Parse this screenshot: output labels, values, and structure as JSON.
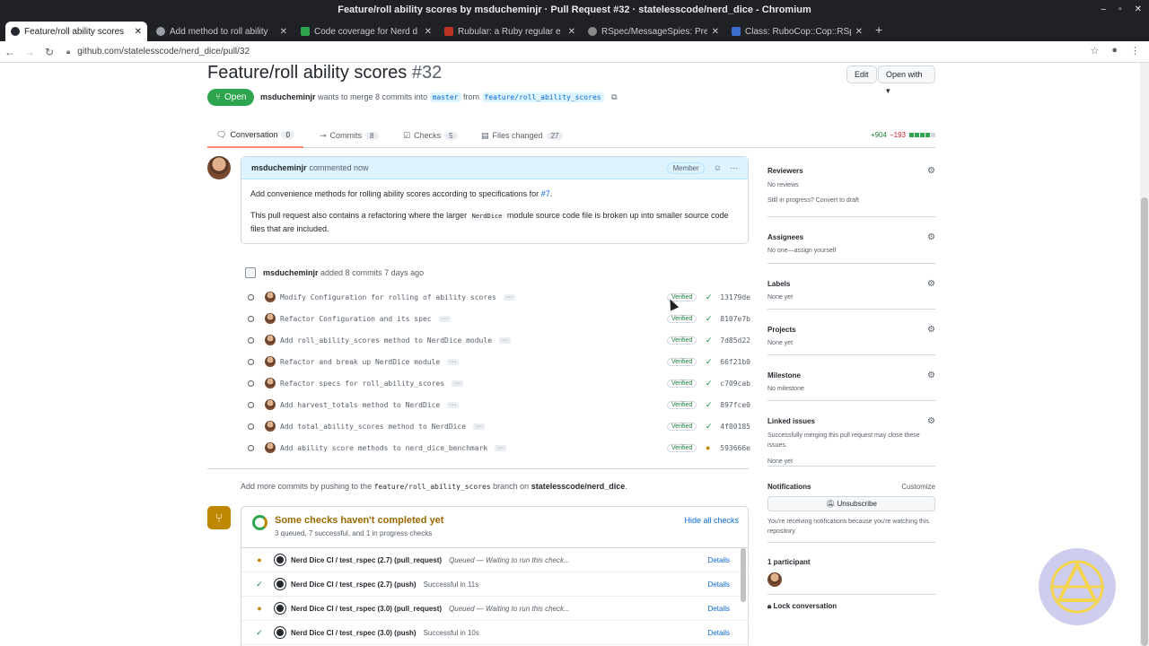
{
  "window": {
    "title": "Feature/roll ability scores by msducheminjr · Pull Request #32 · statelesscode/nerd_dice - Chromium"
  },
  "tabs": [
    {
      "title": "Feature/roll ability scores",
      "color": "#24292f",
      "active": true
    },
    {
      "title": "Add method to roll ability",
      "color": "#5f6368",
      "active": false
    },
    {
      "title": "Code coverage for Nerd d",
      "color": "#2da44e",
      "active": false
    },
    {
      "title": "Rubular: a Ruby regular e",
      "color": "#b32",
      "active": false
    },
    {
      "title": "RSpec/MessageSpies: Pre",
      "color": "#8a8a8a",
      "active": false
    },
    {
      "title": "Class: RuboCop::Cop::RSp",
      "color": "#3a6fcf",
      "active": false
    }
  ],
  "address": {
    "url": "github.com/statelesscode/nerd_dice/pull/32"
  },
  "pr": {
    "title": "Feature/roll ability scores",
    "number": "#32",
    "edit_label": "Edit",
    "open_with_label": "Open with ▾",
    "state": "Open",
    "author": "msducheminjr",
    "meta_mid": "wants to merge 8 commits into",
    "base": "master",
    "from": "from",
    "head": "feature/roll_ability_scores",
    "nav": [
      {
        "label": "Conversation",
        "count": "0"
      },
      {
        "label": "Commits",
        "count": "8"
      },
      {
        "label": "Checks",
        "count": "5"
      },
      {
        "label": "Files changed",
        "count": "27"
      }
    ],
    "additions": "+904",
    "deletions": "−193"
  },
  "comment": {
    "author": "msducheminjr",
    "when": "commented now",
    "role": "Member",
    "p1_text": "Add convenience methods for rolling ability scores according to specifications for",
    "p1_link": "#7",
    "p1_end": ".",
    "p2_a": "This pull request also contains a refactoring where the larger",
    "p2_code": "NerdDice",
    "p2_b": "module source code file is broken up into smaller source code files that are included."
  },
  "push_event": {
    "author": "msducheminjr",
    "text": "added 8 commits 7 days ago"
  },
  "commits": [
    {
      "msg": "Modify Configuration for rolling of ability scores",
      "verified": "Verified",
      "status": "✓",
      "sha": "13179de"
    },
    {
      "msg": "Refactor Configuration and its spec",
      "verified": "Verified",
      "status": "✓",
      "sha": "8107e7b"
    },
    {
      "msg": "Add roll_ability_scores method to NerdDice module",
      "verified": "Verified",
      "status": "✓",
      "sha": "7d85d22"
    },
    {
      "msg": "Refactor and break up NerdDice module",
      "verified": "Verified",
      "status": "✓",
      "sha": "66f21b0"
    },
    {
      "msg": "Refactor specs for roll_ability_scores",
      "verified": "Verified",
      "status": "✓",
      "sha": "c709cab"
    },
    {
      "msg": "Add harvest_totals method to NerdDice",
      "verified": "Verified",
      "status": "✓",
      "sha": "897fce0"
    },
    {
      "msg": "Add total_ability_scores method to NerdDice",
      "verified": "Verified",
      "status": "✓",
      "sha": "4f80185"
    },
    {
      "msg": "Add ability score methods to nerd_dice_benchmark",
      "verified": "Verified",
      "status": "●",
      "sha": "593666e"
    }
  ],
  "add_more": {
    "a": "Add more commits by pushing to the",
    "branch": "feature/roll_ability_scores",
    "b": "branch on",
    "repo": "statelesscode/nerd_dice",
    "end": "."
  },
  "checks": {
    "title": "Some checks haven't completed yet",
    "subtitle": "3 queued, 7 successful, and 1 in progress checks",
    "hide_all": "Hide all checks",
    "rows": [
      {
        "state": "●",
        "name": "Nerd Dice CI / test_rspec (2.7) (pull_request)",
        "prefix": "Queued",
        "desc": " — Waiting to run this check...",
        "details": "Details"
      },
      {
        "state": "✓",
        "name": "Nerd Dice CI / test_rspec (2.7) (push)",
        "prefix": "",
        "desc": "Successful in 11s",
        "details": "Details"
      },
      {
        "state": "●",
        "name": "Nerd Dice CI / test_rspec (3.0) (pull_request)",
        "prefix": "Queued",
        "desc": " — Waiting to run this check...",
        "details": "Details"
      },
      {
        "state": "✓",
        "name": "Nerd Dice CI / test_rspec (3.0) (push)",
        "prefix": "",
        "desc": "Successful in 10s",
        "details": "Details"
      }
    ]
  },
  "sidebar": {
    "reviewers": {
      "title": "Reviewers",
      "line1": "No reviews",
      "line2": "Still in progress? Convert to draft"
    },
    "assignees": {
      "title": "Assignees",
      "line1": "No one—assign yourself"
    },
    "labels": {
      "title": "Labels",
      "line1": "None yet"
    },
    "projects": {
      "title": "Projects",
      "line1": "None yet"
    },
    "milestone": {
      "title": "Milestone",
      "line1": "No milestone"
    },
    "linked": {
      "title": "Linked issues",
      "line1": "Successfully merging this pull request may close these issues.",
      "line2": "None yet"
    },
    "notifications": {
      "title": "Notifications",
      "customize": "Customize",
      "button": "Unsubscribe",
      "note": "You're receiving notifications because you're watching this repository."
    },
    "participants": {
      "title": "1 participant"
    },
    "lock": "Lock conversation"
  }
}
